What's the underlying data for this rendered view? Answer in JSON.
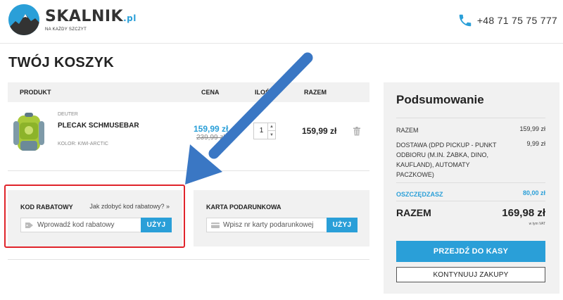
{
  "header": {
    "brand": "SKALNIK",
    "brand_suffix": ".pl",
    "tagline": "NA KAŻDY SZCZYT",
    "phone": "+48 71 75 75 777"
  },
  "page_title": "TWÓJ KOSZYK",
  "cart": {
    "columns": {
      "product": "PRODUKT",
      "price": "CENA",
      "qty": "ILOŚ",
      "total": "RAZEM"
    },
    "items": [
      {
        "brand": "DEUTER",
        "name": "PLECAK SCHMUSEBAR",
        "color": "KOLOR:  KIWI-ARCTIC",
        "price": "159,99 zł",
        "old_price": "239,99 zł",
        "qty": "1",
        "total": "159,99 zł"
      }
    ]
  },
  "coupon": {
    "title": "KOD RABATOWY",
    "link": "Jak zdobyć kod rabatowy? »",
    "placeholder": "Wprowadź kod rabatowy",
    "button": "UŻYJ"
  },
  "giftcard": {
    "title": "KARTA PODARUNKOWA",
    "placeholder": "Wpisz nr karty podarunkowej",
    "button": "UŻYJ"
  },
  "summary": {
    "title": "Podsumowanie",
    "rows": [
      {
        "label": "RAZEM",
        "value": "159,99 zł"
      },
      {
        "label": "DOSTAWA (DPD PICKUP - PUNKT ODBIORU (M.IN. ŻABKA, DINO, KAUFLAND), AUTOMATY PACZKOWE)",
        "value": "9,99 zł"
      }
    ],
    "savings_label": "OSZCZĘDZASZ",
    "savings_value": "80,00 zł",
    "total_label": "RAZEM",
    "total_value": "169,98 zł",
    "vat_note": "w tym VAT",
    "checkout_button": "PRZEJDŹ DO KASY",
    "continue_button": "KONTYNUUJ ZAKUPY"
  },
  "colors": {
    "accent": "#2a9fd8",
    "highlight_frame": "#e0242b",
    "arrow": "#3a77c4"
  }
}
